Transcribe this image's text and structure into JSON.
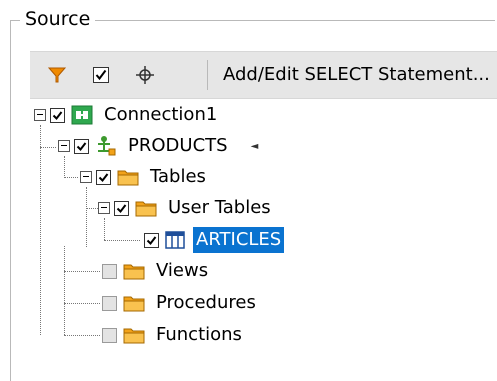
{
  "group": {
    "title": "Source"
  },
  "toolbar": {
    "filter_icon": "filter-icon",
    "check_icon": "checkmark-icon",
    "locate_icon": "crosshair-icon",
    "add_edit_label": "Add/Edit SELECT Statement..."
  },
  "tree": {
    "connection": {
      "label": "Connection1",
      "checked": true,
      "expanded": true,
      "icon": "connection-icon"
    },
    "database": {
      "label": "PRODUCTS",
      "checked": true,
      "expanded": true,
      "icon": "database-tree-icon",
      "marker": "◄"
    },
    "tables": {
      "label": "Tables",
      "checked": true,
      "expanded": true,
      "icon": "folder-icon"
    },
    "user_tables": {
      "label": "User Tables",
      "checked": true,
      "expanded": true,
      "icon": "folder-icon"
    },
    "articles": {
      "label": "ARTICLES",
      "checked": true,
      "selected": true,
      "icon": "table-icon"
    },
    "views": {
      "label": "Views",
      "checked": false,
      "icon": "folder-icon"
    },
    "procedures": {
      "label": "Procedures",
      "checked": false,
      "icon": "folder-icon"
    },
    "functions": {
      "label": "Functions",
      "checked": false,
      "icon": "folder-icon"
    }
  },
  "colors": {
    "selection": "#0a73d0",
    "folder": "#f2a219",
    "connection": "#2fa84f",
    "toolbar_bg": "#e6e6e6"
  }
}
